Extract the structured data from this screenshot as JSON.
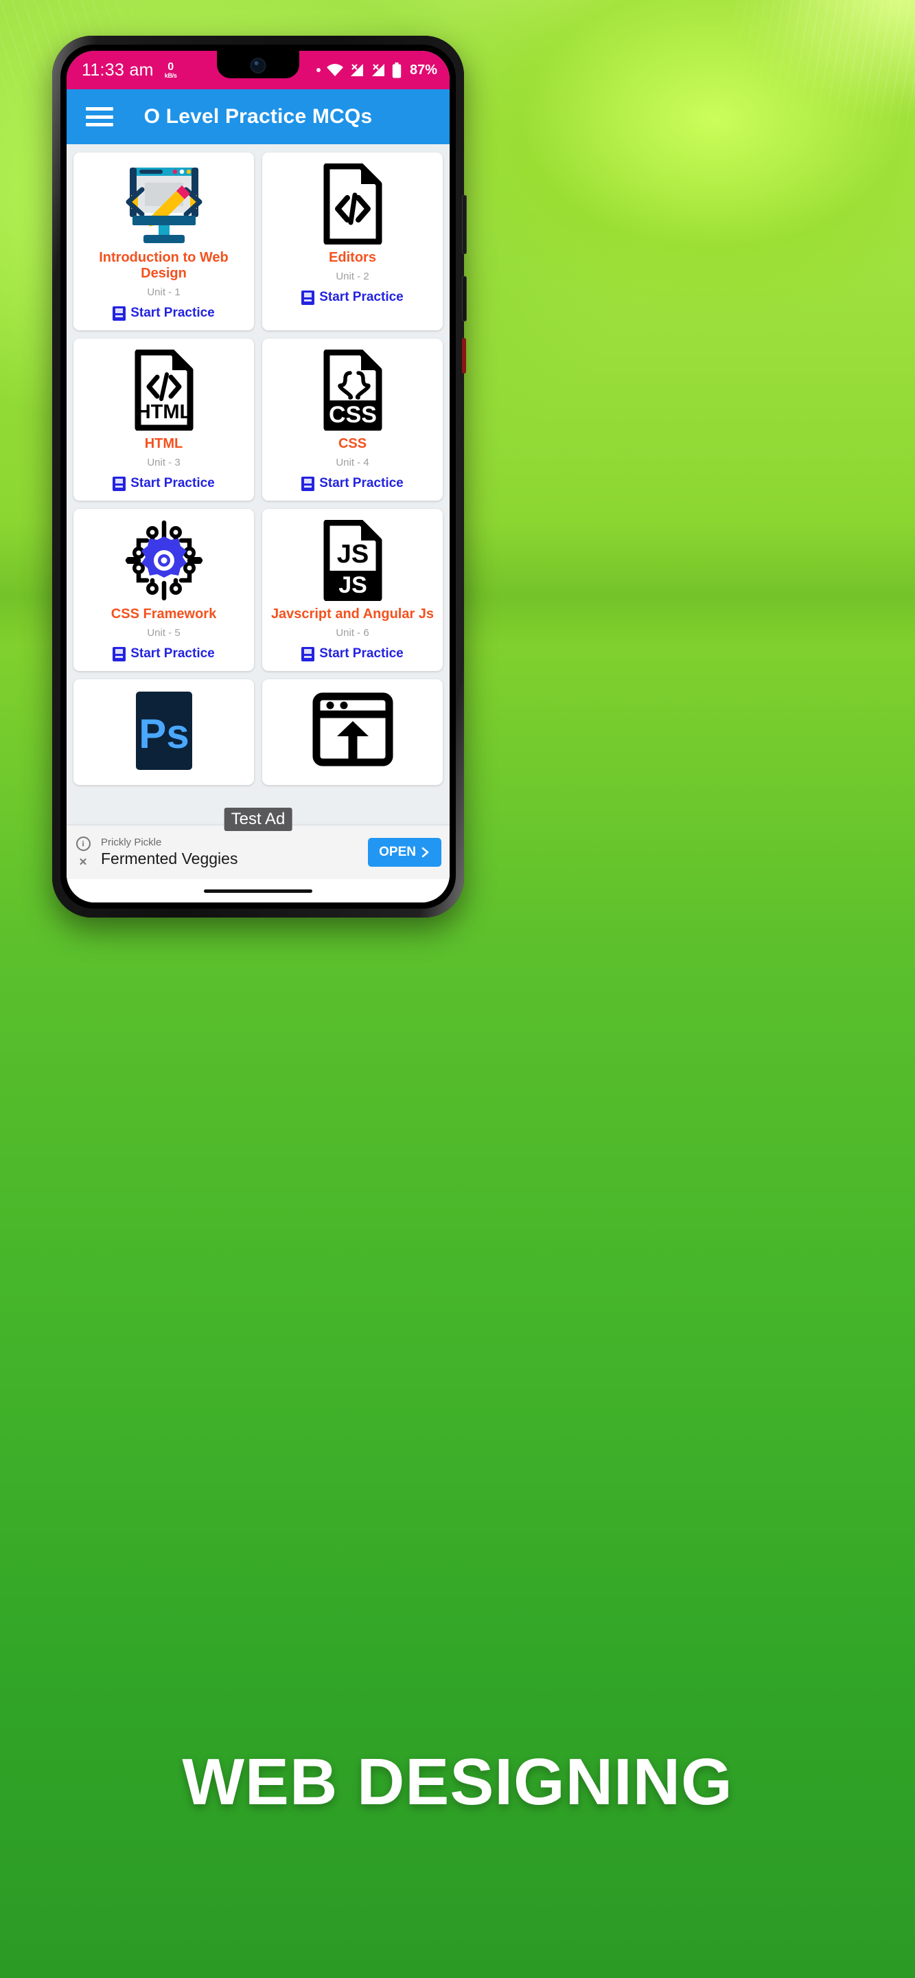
{
  "statusbar": {
    "time": "11:33 am",
    "netspeed_value": "0",
    "netspeed_unit": "kB/s",
    "battery": "87%",
    "icons": [
      "dot-icon",
      "wifi-icon",
      "signal-1-icon",
      "signal-2-icon",
      "battery-icon"
    ],
    "bg_color": "#e10a72"
  },
  "appbar": {
    "menu_icon": "hamburger-menu-icon",
    "title": "O Level Practice MCQs",
    "bg_color": "#1e93e8"
  },
  "theme": {
    "title_color": "#f4511e",
    "link_color": "#2323e0",
    "unit_color": "#9e9e9e",
    "background": "#eceff1"
  },
  "cards": [
    {
      "title": "Introduction to Web Design",
      "unit": "Unit - 1",
      "start_label": "Start Practice",
      "icon": "web-design-monitor-icon"
    },
    {
      "title": "Editors",
      "unit": "Unit - 2",
      "start_label": "Start Practice",
      "icon": "code-file-icon"
    },
    {
      "title": "HTML",
      "unit": "Unit - 3",
      "start_label": "Start Practice",
      "icon": "html-file-icon"
    },
    {
      "title": "CSS",
      "unit": "Unit - 4",
      "start_label": "Start Practice",
      "icon": "css-file-icon"
    },
    {
      "title": "CSS Framework",
      "unit": "Unit - 5",
      "start_label": "Start Practice",
      "icon": "framework-gear-circuit-icon"
    },
    {
      "title": "Javscript and Angular Js",
      "unit": "Unit - 6",
      "start_label": "Start Practice",
      "icon": "js-file-icon"
    },
    {
      "title": "",
      "unit": "",
      "start_label": "",
      "icon": "photoshop-ps-icon"
    },
    {
      "title": "",
      "unit": "",
      "start_label": "",
      "icon": "upload-window-icon"
    }
  ],
  "ad": {
    "test_badge": "Test Ad",
    "info_icon": "info-icon",
    "close_icon": "close-icon",
    "advertiser": "Prickly Pickle",
    "headline": "Fermented Veggies",
    "cta": "OPEN",
    "cta_arrow": "chevron-right-icon",
    "cta_color": "#2196f3"
  },
  "caption": {
    "text": "WEB DESIGNING"
  }
}
